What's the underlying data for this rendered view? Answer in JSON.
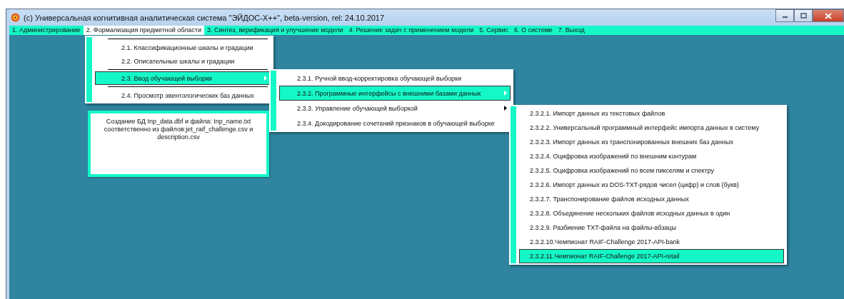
{
  "window": {
    "title": "(c) Универсальная когнитивная аналитическая система \"ЭЙДОС-X++\", beta-version, rel: 24.10.2017"
  },
  "menu_bar": [
    {
      "label": "1. Администрирование",
      "selected": false
    },
    {
      "label": "2. Формализация предметной области",
      "selected": true
    },
    {
      "label": "3. Синтез, верификация и улучшение модели",
      "selected": false
    },
    {
      "label": "4. Решение задач с применением модели",
      "selected": false
    },
    {
      "label": "5. Сервис",
      "selected": false
    },
    {
      "label": "6. О системе",
      "selected": false
    },
    {
      "label": "7. Выход",
      "selected": false
    }
  ],
  "menus": [
    {
      "items": [
        {
          "kind": "separator"
        },
        {
          "kind": "item",
          "label": "2.1. Классификационные шкалы и градации",
          "selected": false,
          "submenu": false
        },
        {
          "kind": "item",
          "label": "2.2. Описательные шкалы и градации",
          "selected": false,
          "submenu": false
        },
        {
          "kind": "separator"
        },
        {
          "kind": "item",
          "label": "2.3. Ввод обучающей выборки",
          "selected": true,
          "submenu": true
        },
        {
          "kind": "separator"
        },
        {
          "kind": "item",
          "label": "2.4. Просмотр эвентологических баз данных",
          "selected": false,
          "submenu": false
        }
      ]
    },
    {
      "items": [
        {
          "kind": "item",
          "label": "2.3.1. Ручной ввод-корректировка обучающей выборки",
          "selected": false,
          "submenu": false
        },
        {
          "kind": "item",
          "label": "2.3.2. Программные интерфейсы с внешними базами данных",
          "selected": true,
          "submenu": true
        },
        {
          "kind": "item",
          "label": "2.3.3. Управление обучающей выборкой",
          "selected": false,
          "submenu": true
        },
        {
          "kind": "item",
          "label": "2.3.4. Докодирование сочетаний признаков в обучающей выборке",
          "selected": false,
          "submenu": false
        }
      ]
    },
    {
      "items": [
        {
          "kind": "item",
          "label": "2.3.2.1. Импорт данных из текстовых файлов",
          "selected": false,
          "submenu": false
        },
        {
          "kind": "item",
          "label": "2.3.2.2. Универсальный программный интерфейс импорта данных в систему",
          "selected": false,
          "submenu": false
        },
        {
          "kind": "item",
          "label": "2.3.2.3. Импорт данных из транспонированных внешних баз данных",
          "selected": false,
          "submenu": false
        },
        {
          "kind": "item",
          "label": "2.3.2.4. Оцифровка изображений по внешним контурам",
          "selected": false,
          "submenu": false
        },
        {
          "kind": "item",
          "label": "2.3.2.5. Оцифровка изображений по всем пикселям и спектру",
          "selected": false,
          "submenu": false
        },
        {
          "kind": "item",
          "label": "2.3.2.6. Импорт данных из DOS-TXT-рядов чисел (цифр) и слов (букв)",
          "selected": false,
          "submenu": false
        },
        {
          "kind": "item",
          "label": "2.3.2.7. Транспонирование файлов исходных данных",
          "selected": false,
          "submenu": false
        },
        {
          "kind": "item",
          "label": "2.3.2.8. Объединение нескольких файлов исходных данных в один",
          "selected": false,
          "submenu": false
        },
        {
          "kind": "item",
          "label": "2.3.2.9. Разбиение TXT-файла на файлы-абзацы",
          "selected": false,
          "submenu": false
        },
        {
          "kind": "item",
          "label": "2.3.2.10.Чемпионат RAIF-Challenge 2017-API-bank",
          "selected": false,
          "submenu": false
        },
        {
          "kind": "item",
          "label": "2.3.2.11.Чемпионат RAIF-Challenge 2017-API-retail",
          "selected": true,
          "submenu": false
        }
      ]
    }
  ],
  "description": "Создание БД Inp_data.dbf и файла: Inp_name.txt соответственно из файлов:jet_raif_challenge.csv и description.csv"
}
